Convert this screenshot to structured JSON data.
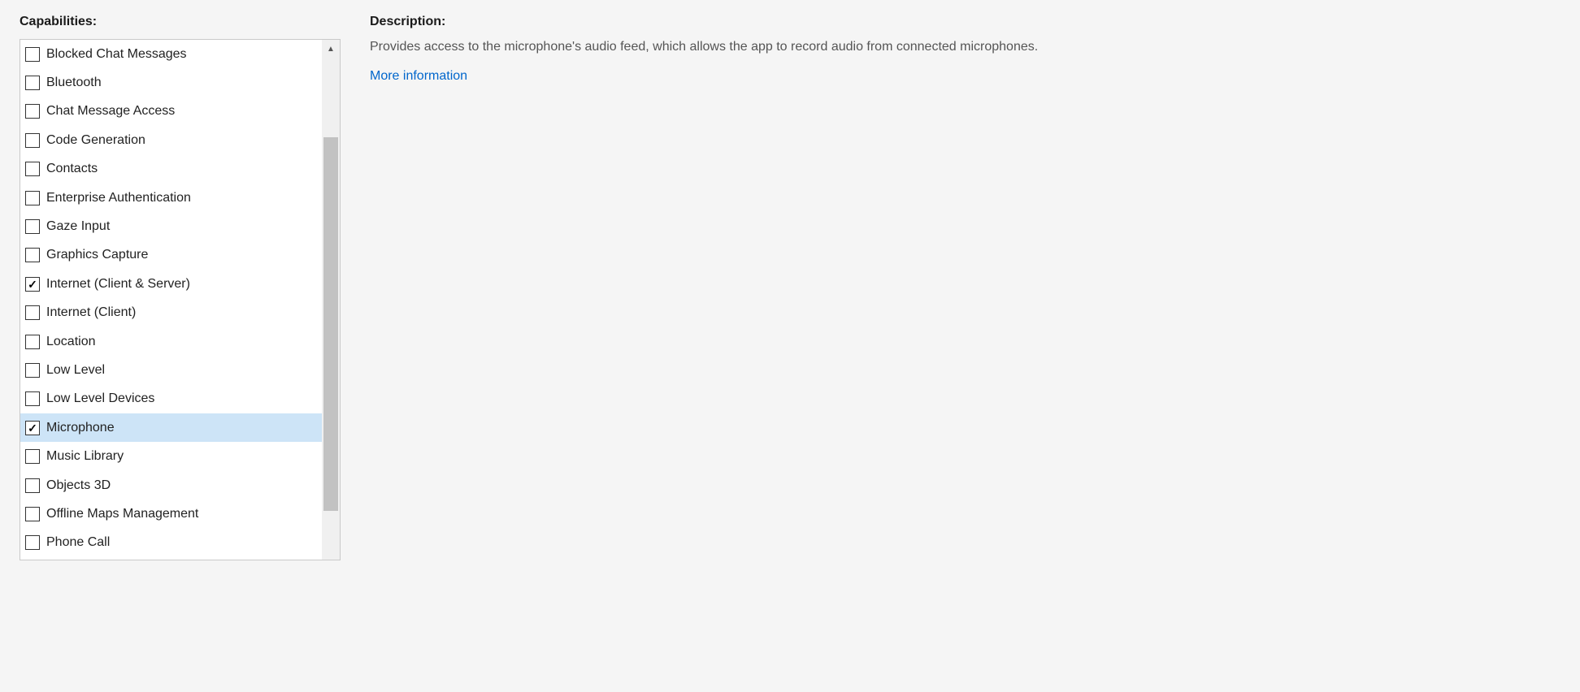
{
  "left": {
    "heading": "Capabilities:",
    "items": [
      {
        "label": "Blocked Chat Messages",
        "checked": false,
        "selected": false
      },
      {
        "label": "Bluetooth",
        "checked": false,
        "selected": false
      },
      {
        "label": "Chat Message Access",
        "checked": false,
        "selected": false
      },
      {
        "label": "Code Generation",
        "checked": false,
        "selected": false
      },
      {
        "label": "Contacts",
        "checked": false,
        "selected": false
      },
      {
        "label": "Enterprise Authentication",
        "checked": false,
        "selected": false
      },
      {
        "label": "Gaze Input",
        "checked": false,
        "selected": false
      },
      {
        "label": "Graphics Capture",
        "checked": false,
        "selected": false
      },
      {
        "label": "Internet (Client & Server)",
        "checked": true,
        "selected": false
      },
      {
        "label": "Internet (Client)",
        "checked": false,
        "selected": false
      },
      {
        "label": "Location",
        "checked": false,
        "selected": false
      },
      {
        "label": "Low Level",
        "checked": false,
        "selected": false
      },
      {
        "label": "Low Level Devices",
        "checked": false,
        "selected": false
      },
      {
        "label": "Microphone",
        "checked": true,
        "selected": true
      },
      {
        "label": "Music Library",
        "checked": false,
        "selected": false
      },
      {
        "label": "Objects 3D",
        "checked": false,
        "selected": false
      },
      {
        "label": "Offline Maps Management",
        "checked": false,
        "selected": false
      },
      {
        "label": "Phone Call",
        "checked": false,
        "selected": false
      }
    ]
  },
  "right": {
    "heading": "Description:",
    "text": "Provides access to the microphone's audio feed, which allows the app to record audio from connected microphones.",
    "link_label": "More information"
  }
}
